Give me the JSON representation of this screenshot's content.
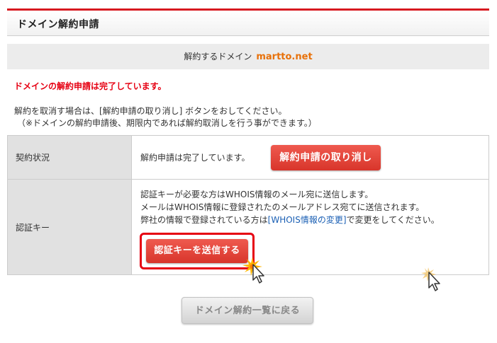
{
  "header": {
    "title": "ドメイン解約申請"
  },
  "banner": {
    "label": "解約するドメイン",
    "domain": "martto.net"
  },
  "status_message": "ドメインの解約申請は完了しています。",
  "info": {
    "line1": "解約を取消す場合は、[解約申請の取り消し] ボタンをおしてください。",
    "line2": "（※ドメインの解約申請後、期限内であれば解約取消しを行う事ができます。）"
  },
  "table": {
    "row1": {
      "label": "契約状況",
      "value": "解約申請は完了しています。",
      "cancel_button": "解約申請の取り消し"
    },
    "row2": {
      "label": "認証キー",
      "line1": "認証キーが必要な方はWHOIS情報のメール宛に送信します。",
      "line2": "メールはWHOIS情報に登録されたのメールアドレス宛てに送信されます。",
      "line3_pre": "弊社の情報で登録されている方は",
      "line3_link": "[WHOIS情報の変更]",
      "line3_post": "で変更をしてください。",
      "send_button": "認証キーを送信する"
    }
  },
  "footer": {
    "back_button": "ドメイン解約一覧に戻る"
  },
  "colors": {
    "accent_red": "#e60012",
    "domain_orange": "#e8710a",
    "link_blue": "#1a5fb4"
  },
  "icons": [
    "arrow-cursor-icon",
    "click-burst-icon"
  ]
}
